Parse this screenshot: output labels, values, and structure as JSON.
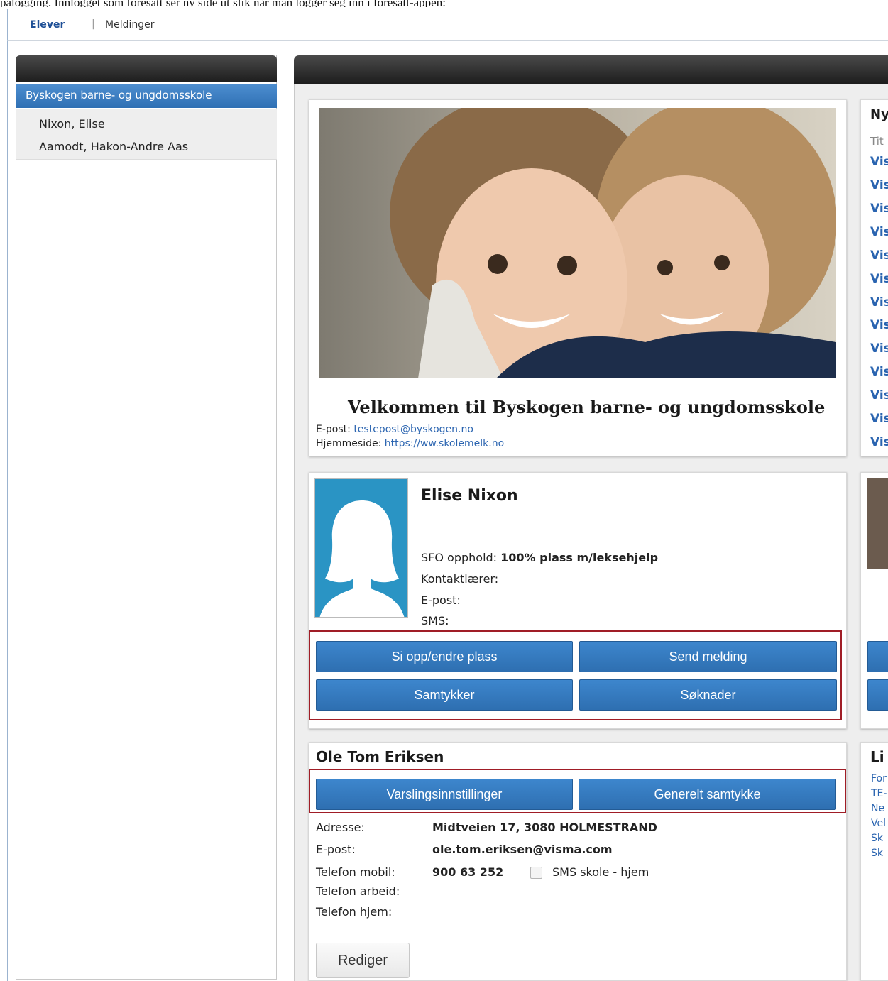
{
  "top_text": "pålogging. Innlogget som foresatt ser ny side ut slik når man logger seg inn i foresatt-appen:",
  "nav": {
    "elever": "Elever",
    "separator": "|",
    "meldinger": "Meldinger"
  },
  "sidebar": {
    "school": "Byskogen barne- og ungdomsskole",
    "students": [
      "Nixon, Elise",
      "Aamodt, Hakon-Andre Aas"
    ]
  },
  "welcome": {
    "title": "Velkommen til Byskogen barne- og ungdomsskole",
    "email_label": "E-post:",
    "email_value": "testepost@byskogen.no",
    "homepage_label": "Hjemmeside:",
    "homepage_value": "https://ww.skolemelk.no"
  },
  "student_card": {
    "name": "Elise Nixon",
    "sfo_label": "SFO opphold:",
    "sfo_value": "100% plass m/leksehjelp",
    "teacher_label": "Kontaktlærer:",
    "email_label": "E-post:",
    "sms_label": "SMS:",
    "buttons": {
      "si_opp": "Si opp/endre plass",
      "send_melding": "Send melding",
      "samtykker": "Samtykker",
      "soknader": "Søknader"
    }
  },
  "parent_card": {
    "name": "Ole Tom Eriksen",
    "buttons": {
      "varsling": "Varslingsinnstillinger",
      "samtykke": "Generelt samtykke"
    },
    "address_label": "Adresse:",
    "address_value": "Midtveien 17, 3080 HOLMESTRAND",
    "email_label": "E-post:",
    "email_value": "ole.tom.eriksen@visma.com",
    "mobile_label": "Telefon mobil:",
    "mobile_value": "900 63 252",
    "sms_checkbox_label": "SMS skole - hjem",
    "work_label": "Telefon arbeid:",
    "home_label": "Telefon hjem:",
    "edit_button": "Rediger"
  },
  "right_column": {
    "news_title": "Ny",
    "news_header": "Tit",
    "news_links": [
      "Vis",
      "Vis",
      "Vis",
      "Vis",
      "Vis",
      "Vis",
      "Vis",
      "Vis",
      "Vis",
      "Vis",
      "Vis",
      "Vis",
      "Vis"
    ],
    "links_title": "Li",
    "link_items": [
      "For",
      "TE-",
      "Ne",
      "Vel",
      "Sk",
      "Sk"
    ]
  },
  "colors": {
    "accent_blue": "#2e6fb1",
    "highlight_red": "#a01d26",
    "avatar_blue": "#2a94c4"
  }
}
